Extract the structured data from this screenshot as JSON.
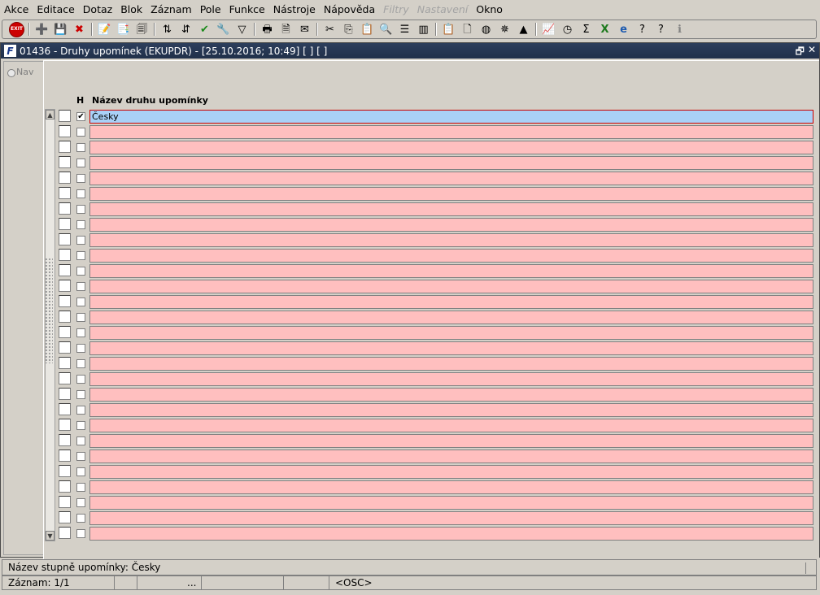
{
  "menu": {
    "items": [
      {
        "label": "Akce",
        "disabled": false
      },
      {
        "label": "Editace",
        "disabled": false
      },
      {
        "label": "Dotaz",
        "disabled": false
      },
      {
        "label": "Blok",
        "disabled": false
      },
      {
        "label": "Záznam",
        "disabled": false
      },
      {
        "label": "Pole",
        "disabled": false
      },
      {
        "label": "Funkce",
        "disabled": false
      },
      {
        "label": "Nástroje",
        "disabled": false
      },
      {
        "label": "Nápověda",
        "disabled": false
      },
      {
        "label": "Filtry",
        "disabled": true
      },
      {
        "label": "Nastavení",
        "disabled": true
      },
      {
        "label": "Okno",
        "disabled": false
      }
    ]
  },
  "toolbar": {
    "exit_label": "EXIT",
    "icons": [
      "exit-icon",
      "sep",
      "insert-record-icon",
      "save-record-icon",
      "delete-record-icon",
      "sep",
      "enter-query-icon",
      "execute-query-icon",
      "cancel-query-icon",
      "sep",
      "sort-asc-icon",
      "sort-desc-icon",
      "check-icon",
      "wrench-icon",
      "filter-icon",
      "sep",
      "print-icon",
      "print-preview-icon",
      "email-icon",
      "sep",
      "cut-icon",
      "copy-icon",
      "paste-icon",
      "find-icon",
      "list-icon",
      "columns-icon",
      "sep",
      "clipboard-icon",
      "document-icon",
      "globe-icon",
      "gear-wheel-icon",
      "triangle-icon",
      "sep",
      "chart-icon",
      "clock-icon",
      "sum-icon",
      "excel-icon",
      "ie-icon",
      "help-folder-icon",
      "help-icon",
      "info-icon"
    ]
  },
  "window": {
    "title": "01436 - Druhy upomínek (EKUPDR) - [25.10.2016; 10:49]  [ ]  [ ]",
    "app_icon": "F",
    "restore_glyph": "🗗",
    "close_glyph": "✕"
  },
  "nav": {
    "label": "Nav"
  },
  "grid": {
    "headers": {
      "h": "H",
      "name": "Název druhu upomínky"
    },
    "rows": [
      {
        "name": "Česky",
        "checked": true,
        "active": true
      }
    ],
    "empty_rows": 27
  },
  "status": {
    "message": "Název stupně upomínky: Česky",
    "record": "Záznam: 1/1",
    "ellipsis": "...",
    "mode": "<OSC>"
  }
}
